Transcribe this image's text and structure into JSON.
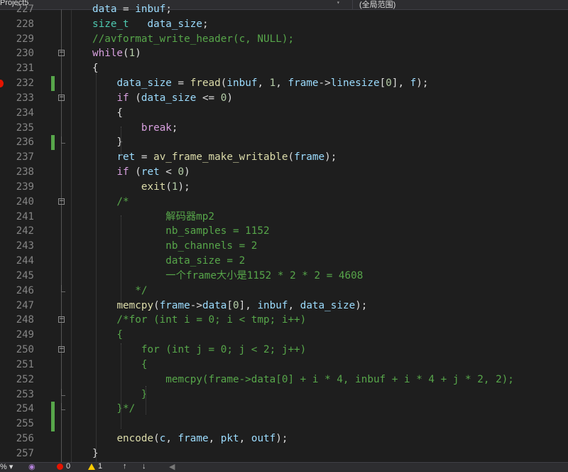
{
  "topbar": {
    "project": "Project5",
    "scope": "(全局范围)"
  },
  "editor": {
    "lines": [
      {
        "n": "227",
        "parts": [
          {
            "t": "data",
            "c": "var"
          },
          {
            "t": " = "
          },
          {
            "t": "inbuf",
            "c": "var"
          },
          {
            "t": ";"
          }
        ]
      },
      {
        "n": "228",
        "parts": [
          {
            "t": "size_t",
            "c": "type"
          },
          {
            "t": "   "
          },
          {
            "t": "data_size",
            "c": "var"
          },
          {
            "t": ";"
          }
        ]
      },
      {
        "n": "229",
        "parts": [
          {
            "t": "//avformat_write_header(c, NULL);",
            "c": "cmt"
          }
        ]
      },
      {
        "n": "230",
        "parts": [
          {
            "t": "while",
            "c": "ctl"
          },
          {
            "t": "("
          },
          {
            "t": "1",
            "c": "num"
          },
          {
            "t": ")"
          }
        ]
      },
      {
        "n": "231",
        "parts": [
          {
            "t": "{"
          }
        ]
      },
      {
        "n": "232",
        "parts": [
          {
            "t": "    "
          },
          {
            "t": "data_size",
            "c": "var"
          },
          {
            "t": " = "
          },
          {
            "t": "fread",
            "c": "fn"
          },
          {
            "t": "("
          },
          {
            "t": "inbuf",
            "c": "var"
          },
          {
            "t": ", "
          },
          {
            "t": "1",
            "c": "num"
          },
          {
            "t": ", "
          },
          {
            "t": "frame",
            "c": "var"
          },
          {
            "t": "->"
          },
          {
            "t": "linesize",
            "c": "var"
          },
          {
            "t": "["
          },
          {
            "t": "0",
            "c": "num"
          },
          {
            "t": "], "
          },
          {
            "t": "f",
            "c": "var"
          },
          {
            "t": ");"
          }
        ]
      },
      {
        "n": "233",
        "parts": [
          {
            "t": "    "
          },
          {
            "t": "if",
            "c": "ctl"
          },
          {
            "t": " ("
          },
          {
            "t": "data_size",
            "c": "var"
          },
          {
            "t": " <= "
          },
          {
            "t": "0",
            "c": "num"
          },
          {
            "t": ")"
          }
        ]
      },
      {
        "n": "234",
        "parts": [
          {
            "t": "    {"
          }
        ]
      },
      {
        "n": "235",
        "parts": [
          {
            "t": "        "
          },
          {
            "t": "break",
            "c": "ctl"
          },
          {
            "t": ";"
          }
        ]
      },
      {
        "n": "236",
        "parts": [
          {
            "t": "    }"
          }
        ]
      },
      {
        "n": "237",
        "parts": [
          {
            "t": "    "
          },
          {
            "t": "ret",
            "c": "var"
          },
          {
            "t": " = "
          },
          {
            "t": "av_frame_make_writable",
            "c": "fn"
          },
          {
            "t": "("
          },
          {
            "t": "frame",
            "c": "var"
          },
          {
            "t": ");"
          }
        ]
      },
      {
        "n": "238",
        "parts": [
          {
            "t": "    "
          },
          {
            "t": "if",
            "c": "ctl"
          },
          {
            "t": " ("
          },
          {
            "t": "ret",
            "c": "var"
          },
          {
            "t": " < "
          },
          {
            "t": "0",
            "c": "num"
          },
          {
            "t": ")"
          }
        ]
      },
      {
        "n": "239",
        "parts": [
          {
            "t": "        "
          },
          {
            "t": "exit",
            "c": "fn"
          },
          {
            "t": "("
          },
          {
            "t": "1",
            "c": "num"
          },
          {
            "t": ");"
          }
        ]
      },
      {
        "n": "240",
        "parts": [
          {
            "t": "    /*",
            "c": "cmt"
          }
        ]
      },
      {
        "n": "241",
        "parts": [
          {
            "t": "            解码器mp2",
            "c": "cmt"
          }
        ]
      },
      {
        "n": "242",
        "parts": [
          {
            "t": "            nb_samples = 1152",
            "c": "cmt"
          }
        ]
      },
      {
        "n": "243",
        "parts": [
          {
            "t": "            nb_channels = 2",
            "c": "cmt"
          }
        ]
      },
      {
        "n": "244",
        "parts": [
          {
            "t": "            data_size = 2",
            "c": "cmt"
          }
        ]
      },
      {
        "n": "245",
        "parts": [
          {
            "t": "            一个frame大小是1152 * 2 * 2 = 4608",
            "c": "cmt"
          }
        ]
      },
      {
        "n": "246",
        "parts": [
          {
            "t": "       */",
            "c": "cmt"
          }
        ]
      },
      {
        "n": "247",
        "parts": [
          {
            "t": "    "
          },
          {
            "t": "memcpy",
            "c": "fn"
          },
          {
            "t": "("
          },
          {
            "t": "frame",
            "c": "var"
          },
          {
            "t": "->"
          },
          {
            "t": "data",
            "c": "var"
          },
          {
            "t": "["
          },
          {
            "t": "0",
            "c": "num"
          },
          {
            "t": "], "
          },
          {
            "t": "inbuf",
            "c": "var"
          },
          {
            "t": ", "
          },
          {
            "t": "data_size",
            "c": "var"
          },
          {
            "t": ");"
          }
        ]
      },
      {
        "n": "248",
        "parts": [
          {
            "t": "    /*for (int i = 0; i < tmp; i++)",
            "c": "cmt"
          }
        ]
      },
      {
        "n": "249",
        "parts": [
          {
            "t": "    {",
            "c": "cmt"
          }
        ]
      },
      {
        "n": "250",
        "parts": [
          {
            "t": "        for (int j = 0; j < 2; j++)",
            "c": "cmt"
          }
        ]
      },
      {
        "n": "251",
        "parts": [
          {
            "t": "        {",
            "c": "cmt"
          }
        ]
      },
      {
        "n": "252",
        "parts": [
          {
            "t": "            memcpy(frame->data[0] + i * 4, inbuf + i * 4 + j * 2, 2);",
            "c": "cmt"
          }
        ]
      },
      {
        "n": "253",
        "parts": [
          {
            "t": "        }",
            "c": "cmt"
          }
        ]
      },
      {
        "n": "254",
        "parts": [
          {
            "t": "    }*/",
            "c": "cmt"
          }
        ]
      },
      {
        "n": "255",
        "parts": []
      },
      {
        "n": "256",
        "parts": [
          {
            "t": "    "
          },
          {
            "t": "encode",
            "c": "fn"
          },
          {
            "t": "("
          },
          {
            "t": "c",
            "c": "var"
          },
          {
            "t": ", "
          },
          {
            "t": "frame",
            "c": "var"
          },
          {
            "t": ", "
          },
          {
            "t": "pkt",
            "c": "var"
          },
          {
            "t": ", "
          },
          {
            "t": "outf",
            "c": "var"
          },
          {
            "t": ");"
          }
        ]
      },
      {
        "n": "257",
        "parts": [
          {
            "t": "}"
          }
        ]
      }
    ]
  },
  "statusbar": {
    "zoom": "% ▾",
    "errors": "0",
    "warnings": "1",
    "up": "↑",
    "down": "↓",
    "left": "◀"
  },
  "colors": {
    "changed": "#57a64a",
    "breakpoint": "#e51400"
  }
}
